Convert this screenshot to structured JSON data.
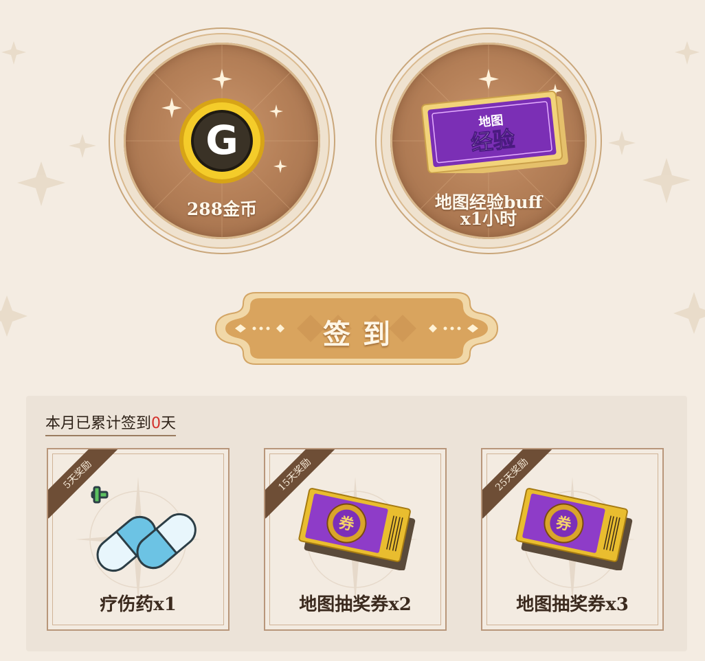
{
  "rewards": [
    {
      "label": "288金币",
      "icon": "gold-coin-icon",
      "coin_letter": "G"
    },
    {
      "label_line1": "地图经验buff",
      "label_line2": "x1小时",
      "icon": "map-exp-card-icon",
      "card_line1": "地图",
      "card_line2": "经验"
    }
  ],
  "checkin": {
    "label": "签到"
  },
  "monthly": {
    "prefix": "本月已累计签到",
    "count": "0",
    "suffix": "天",
    "cards": [
      {
        "badge": "5天奖励",
        "label": "疗伤药x1",
        "icon": "healing-pill-icon"
      },
      {
        "badge": "15天奖励",
        "label": "地图抽奖券x2",
        "icon": "lottery-ticket-icon",
        "ticket_char": "券"
      },
      {
        "badge": "25天奖励",
        "label": "地图抽奖券x3",
        "icon": "lottery-ticket-icon",
        "ticket_char": "券"
      }
    ]
  },
  "colors": {
    "background": "#f4ece2",
    "accent_count": "#d3302b",
    "button_gold": "#d9a45e",
    "ribbon": "#6e4e36",
    "exp_card_purple": "#7b2fb5"
  }
}
